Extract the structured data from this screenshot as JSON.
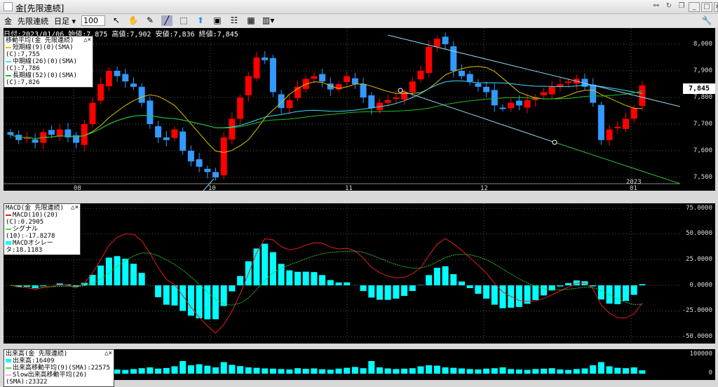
{
  "window": {
    "title": "金[先限連続]"
  },
  "toolbar": {
    "symbol": "金",
    "contract": "先限連続",
    "period": "日足 ▾",
    "count": "100"
  },
  "info": "日付:2023/01/06 始値:7,875 高値:7,902 安値:7,836 終値:7,845",
  "ma_legend": {
    "title": "移動平均(金 先限連続)",
    "items": [
      "短期線(9)(0)(SMA)(C):7,755",
      "中期線(26)(0)(SMA)(C):7,786",
      "長期線(52)(0)(SMA)(C):7,826"
    ],
    "colors": [
      "#e0c000",
      "#40e0ff",
      "#20c020"
    ]
  },
  "macd_legend": {
    "title": "MACD(金 先限連続)",
    "items": [
      "MACD(10)(20)(C):0.2905",
      "シグナル(10):-17.8278",
      "MACDオシレータ:18.1183"
    ],
    "colors": [
      "#e02020",
      "#40e040",
      "#00ffff"
    ]
  },
  "vol_legend": {
    "title": "出来高(金 先限連続)",
    "items": [
      "出来高:16409",
      "出来高移動平均(9)(SMA):22575",
      "Slow出来高移動平均(26)(SMA):23322"
    ],
    "colors": [
      "#00ffff",
      "#40e040",
      "#ffaaff"
    ]
  },
  "price_axis": [
    "8,000",
    "7,900",
    "7,800",
    "7,700",
    "7,600",
    "7,500"
  ],
  "current_price": "7,845",
  "date_labels": [
    "08",
    "10",
    "11",
    "12",
    "01"
  ],
  "year_label": "2023",
  "macd_axis": [
    "75.0000",
    "50.0000",
    "25.0000",
    "0.0000",
    "-25.0000",
    "-50.0000"
  ],
  "vol_axis": [
    "100000",
    "0"
  ],
  "colors": {
    "up": "#ff0000",
    "down": "#3399ff"
  },
  "chart_data": {
    "type": "candlestick",
    "closes": [
      7660,
      7640,
      7650,
      7630,
      7670,
      7660,
      7680,
      7650,
      7630,
      7700,
      7780,
      7850,
      7900,
      7880,
      7860,
      7840,
      7780,
      7700,
      7650,
      7640,
      7680,
      7600,
      7560,
      7540,
      7520,
      7500,
      7650,
      7720,
      7800,
      7880,
      7950,
      7940,
      7820,
      7760,
      7790,
      7840,
      7870,
      7880,
      7860,
      7830,
      7850,
      7880,
      7850,
      7800,
      7760,
      7780,
      7790,
      7800,
      7820,
      7860,
      7900,
      7990,
      8020,
      8000,
      7900,
      7880,
      7860,
      7840,
      7820,
      7770,
      7760,
      7780,
      7770,
      7790,
      7800,
      7820,
      7840,
      7850,
      7860,
      7870,
      7840,
      7780,
      7640,
      7680,
      7690,
      7720,
      7760,
      7845
    ],
    "volumes": [
      22,
      18,
      25,
      20,
      15,
      19,
      23,
      17,
      21,
      30,
      35,
      28,
      25,
      20,
      18,
      22,
      26,
      30,
      24,
      27,
      35,
      60,
      40,
      45,
      38,
      30,
      55,
      42,
      36,
      30,
      28,
      25,
      24,
      22,
      20,
      26,
      23,
      25,
      21,
      19,
      24,
      28,
      32,
      26,
      60,
      30,
      25,
      22,
      24,
      26,
      35,
      40,
      38,
      30,
      28,
      25,
      22,
      20,
      24,
      26,
      30,
      22,
      20,
      18,
      22,
      24,
      26,
      20,
      18,
      22,
      25,
      40,
      55,
      35,
      28,
      26,
      30,
      16
    ]
  }
}
